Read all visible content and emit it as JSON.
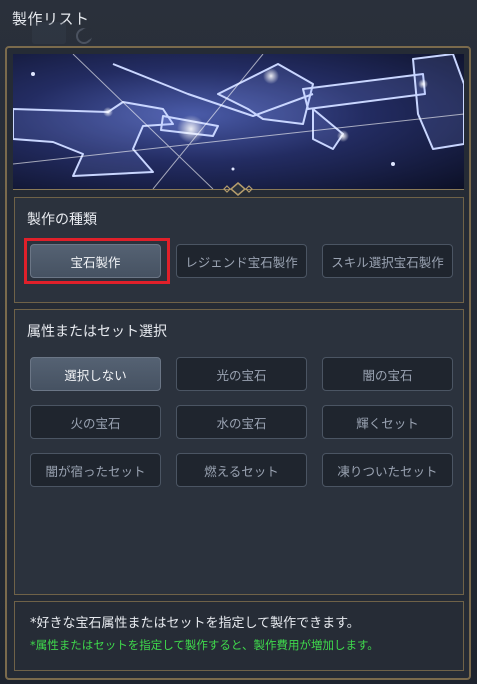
{
  "window": {
    "title": "製作リスト"
  },
  "craft_type": {
    "heading": "製作の種類",
    "options": [
      "宝石製作",
      "レジェンド宝石製作",
      "スキル選択宝石製作"
    ],
    "selected": "宝石製作"
  },
  "attribute": {
    "heading": "属性またはセット選択",
    "options": [
      "選択しない",
      "光の宝石",
      "闇の宝石",
      "火の宝石",
      "水の宝石",
      "輝くセット",
      "闇が宿ったセット",
      "燃えるセット",
      "凍りついたセット"
    ],
    "selected": "選択しない"
  },
  "notes": {
    "info": "*好きな宝石属性またはセットを指定して製作できます。",
    "warning": "*属性またはセットを指定して製作すると、製作費用が増加します。",
    "warning_color": "#3fd94c"
  },
  "colors": {
    "frame_gold": "#7a6a4c",
    "highlight_red": "#e0202a"
  }
}
